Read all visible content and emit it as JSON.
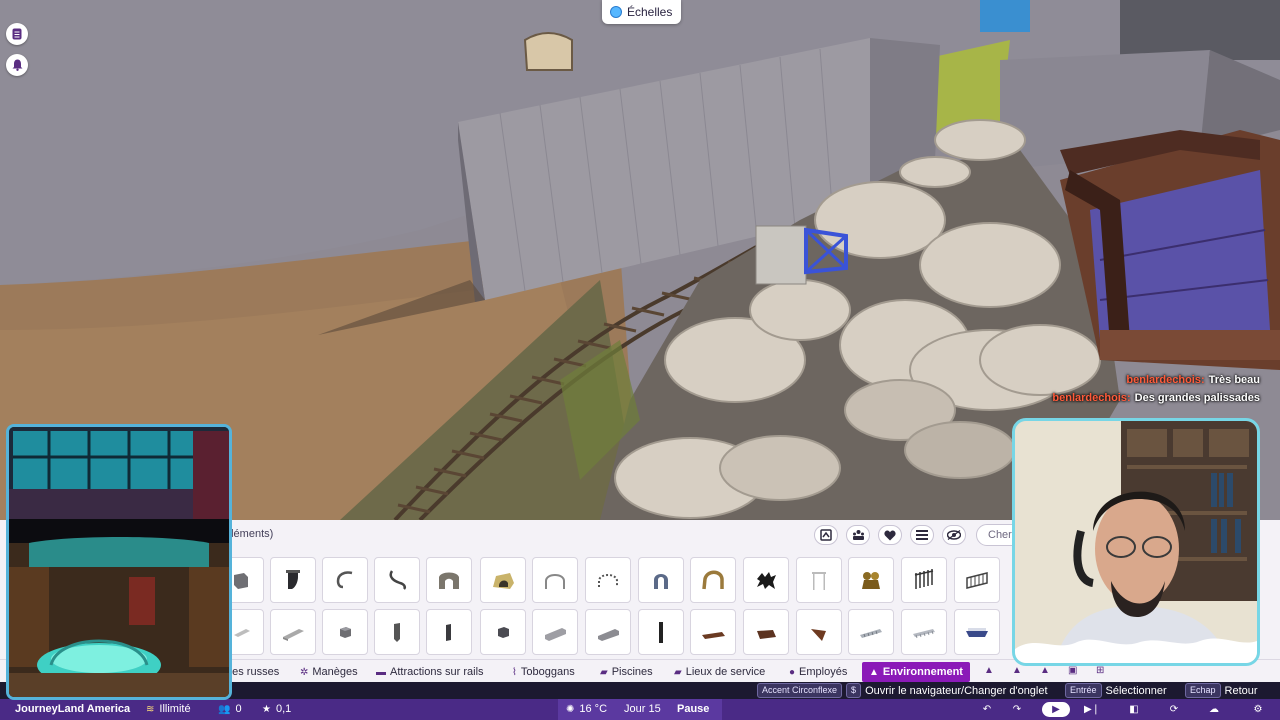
{
  "scene": {
    "scale_label": "Échelles"
  },
  "left_buttons": [
    {
      "icon": "guest-list-icon"
    },
    {
      "icon": "bell-icon"
    }
  ],
  "chat": [
    {
      "user": "benlardechois:",
      "message": "Très beau"
    },
    {
      "user": "benlardechois:",
      "message": "Des grandes palissades"
    }
  ],
  "build_panel": {
    "category_label": "éléments)",
    "search_placeholder": "Cher",
    "tools": [
      "layout-icon",
      "group-icon",
      "heart-icon",
      "list-icon",
      "eye-icon"
    ],
    "row1_items": [
      "block",
      "pipe-elbow",
      "hook",
      "curved-hook",
      "rock-arch",
      "yellow-tunnel",
      "arch-frame",
      "dotted-arch",
      "horseshoe",
      "gold-horseshoe",
      "black-creature",
      "white-frame",
      "gold-statue",
      "fence-gate",
      "fence-panel"
    ],
    "row2_items": [
      "slab",
      "beam",
      "cube",
      "post",
      "short-post",
      "cube-dark",
      "long-block",
      "long-block-2",
      "tall-post",
      "wood-tile",
      "wood-tile-dark",
      "wood-tile-angled",
      "grate",
      "rail-piece",
      "blue-boat"
    ]
  },
  "tabs": [
    {
      "label": "ges russes",
      "icon": ""
    },
    {
      "label": "Manèges",
      "icon": "ride-icon"
    },
    {
      "label": "Attractions sur rails",
      "icon": "rail-icon"
    },
    {
      "label": "Toboggans",
      "icon": "slide-icon"
    },
    {
      "label": "Piscines",
      "icon": "pool-icon"
    },
    {
      "label": "Lieux de service",
      "icon": "shop-icon"
    },
    {
      "label": "Employés",
      "icon": "staff-icon"
    },
    {
      "label": "Environnement",
      "icon": "environment-icon",
      "active": true
    }
  ],
  "hints": {
    "k1": "Accent Circonflexe",
    "k1b": "$",
    "t1": "Ouvrir le navigateur/Changer d'onglet",
    "k2": "Entrée",
    "t2": "Sélectionner",
    "k3": "Echap",
    "t3": "Retour"
  },
  "status": {
    "park_name": "JourneyLand America",
    "money": "Illimité",
    "guests": "0",
    "rating": "0,1",
    "temperature": "16 °C",
    "day": "Jour 15",
    "pause_label": "Pause"
  },
  "colors": {
    "accent": "#8b1ab8",
    "status_bar": "#4a2a86",
    "hint_bar": "#1c1930",
    "chat_user": "#ff5b3a"
  }
}
